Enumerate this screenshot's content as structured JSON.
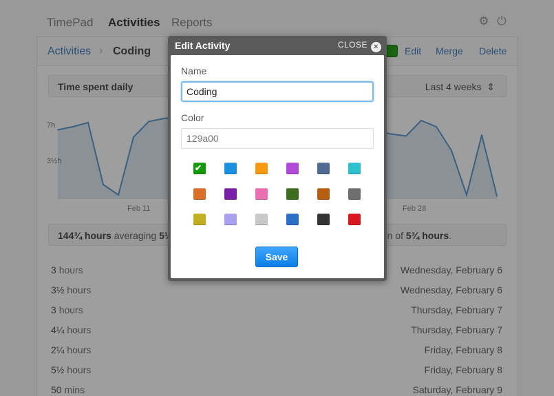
{
  "nav": {
    "items": [
      "TimePad",
      "Activities",
      "Reports"
    ],
    "active": "Activities"
  },
  "breadcrumb": {
    "link": "Activities",
    "separator": "›",
    "current": "Coding"
  },
  "actions": {
    "edit": "Edit",
    "merge": "Merge",
    "delete": "Delete"
  },
  "filter": {
    "title": "Time spent daily",
    "range": "Last 4 weeks",
    "range_arrows": "⇕"
  },
  "chart_data": {
    "type": "area",
    "y_ticks": [
      "7h",
      "3½h"
    ],
    "x_ticks": [
      "Feb 11",
      "Feb 28"
    ],
    "color": "#4a8ec6",
    "values": [
      6.7,
      7.0,
      7.4,
      1.4,
      0.4,
      6.0,
      7.5,
      7.8,
      7.9,
      7.3,
      6.6,
      6.3,
      6.1,
      6.2,
      6.5,
      6.8,
      7.1,
      6.9,
      6.5,
      6.3,
      6.4,
      6.6,
      6.3,
      6.1,
      7.6,
      7.0,
      4.7,
      0.4,
      6.2,
      0.3
    ]
  },
  "summary": {
    "hours": "144¾ hours",
    "averaging": "averaging",
    "avg_trunc": "5¼",
    "tail_prefix": "on of",
    "tail_hours": "5¾ hours",
    "tail_end": "."
  },
  "rows": [
    {
      "duration": "3",
      "unit": "hours",
      "day": "Wednesday, February 6"
    },
    {
      "duration": "3½",
      "unit": "hours",
      "day": "Wednesday, February 6"
    },
    {
      "duration": "3",
      "unit": "hours",
      "day": "Thursday, February 7"
    },
    {
      "duration": "4¼",
      "unit": "hours",
      "day": "Thursday, February 7"
    },
    {
      "duration": "2¼",
      "unit": "hours",
      "day": "Friday, February 8"
    },
    {
      "duration": "5½",
      "unit": "hours",
      "day": "Friday, February 8"
    },
    {
      "duration": "50",
      "unit": "mins",
      "day": "Saturday, February 9"
    }
  ],
  "modal": {
    "title": "Edit Activity",
    "close_label": "CLOSE",
    "close_icon": "×",
    "name_label": "Name",
    "name_value": "Coding",
    "color_label": "Color",
    "color_value": "129a00",
    "save_label": "Save",
    "check_glyph": "✔",
    "selected_color": "#129a00",
    "swatches": [
      "#129a00",
      "#1a8fe0",
      "#f79a10",
      "#b048d8",
      "#4f6b91",
      "#2fc0cd",
      "#d9702a",
      "#7a1fa8",
      "#ea6fb0",
      "#3d6e1f",
      "#b75d10",
      "#6e6e6e",
      "#c2b020",
      "#aaa0f0",
      "#c8c8c8",
      "#2c6fc8",
      "#333333",
      "#d8181e"
    ]
  }
}
